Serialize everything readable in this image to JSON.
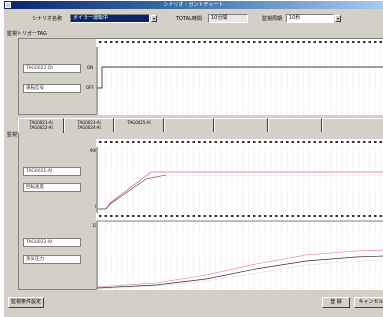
{
  "window": {
    "title": "シナリオ・ガントチャート"
  },
  "toolbar": {
    "scenario_label": "シナリオ名称",
    "scenario_value": "ボイラー運転中",
    "total_time_label": "TOTAL時間",
    "total_time_value": "10分間",
    "monitor_cycle_label": "監視周期",
    "monitor_cycle_value": "10秒"
  },
  "trigger_section": {
    "title": "監視トリガーTAG",
    "tag_field": "TAG0022-DI",
    "name_field": "運転信号",
    "on_label": "ON",
    "off_label": "OFF"
  },
  "tabs": [
    {
      "line1": "TAG0021-AI",
      "line2": "TAG0022-AI"
    },
    {
      "line1": "TAG0023-AI",
      "line2": "TAG0024-AI"
    },
    {
      "line1": "TAG0025-AI",
      "line2": ""
    },
    {
      "line1": "",
      "line2": ""
    },
    {
      "line1": "",
      "line2": ""
    },
    {
      "line1": "",
      "line2": ""
    }
  ],
  "monitor_section": {
    "title": "監視TAG",
    "chart1": {
      "tag_field": "TAG0021-AI",
      "name_field": "回転速度",
      "ymax_label": "9000",
      "ymin_label": "0"
    },
    "chart2": {
      "tag_field": "TAG0022-AI",
      "name_field": "蒸気圧力",
      "ymax_label": "100",
      "ymin_label": "0"
    }
  },
  "footer": {
    "settings_button": "監視条件設定",
    "ok_button": "登 録",
    "cancel_button": "キャンセル"
  },
  "colors": {
    "trace_pink": "#e07090",
    "trace_dark": "#303030",
    "trace_light_pink": "#f0a0c0",
    "grid": "#b0b0b0"
  }
}
